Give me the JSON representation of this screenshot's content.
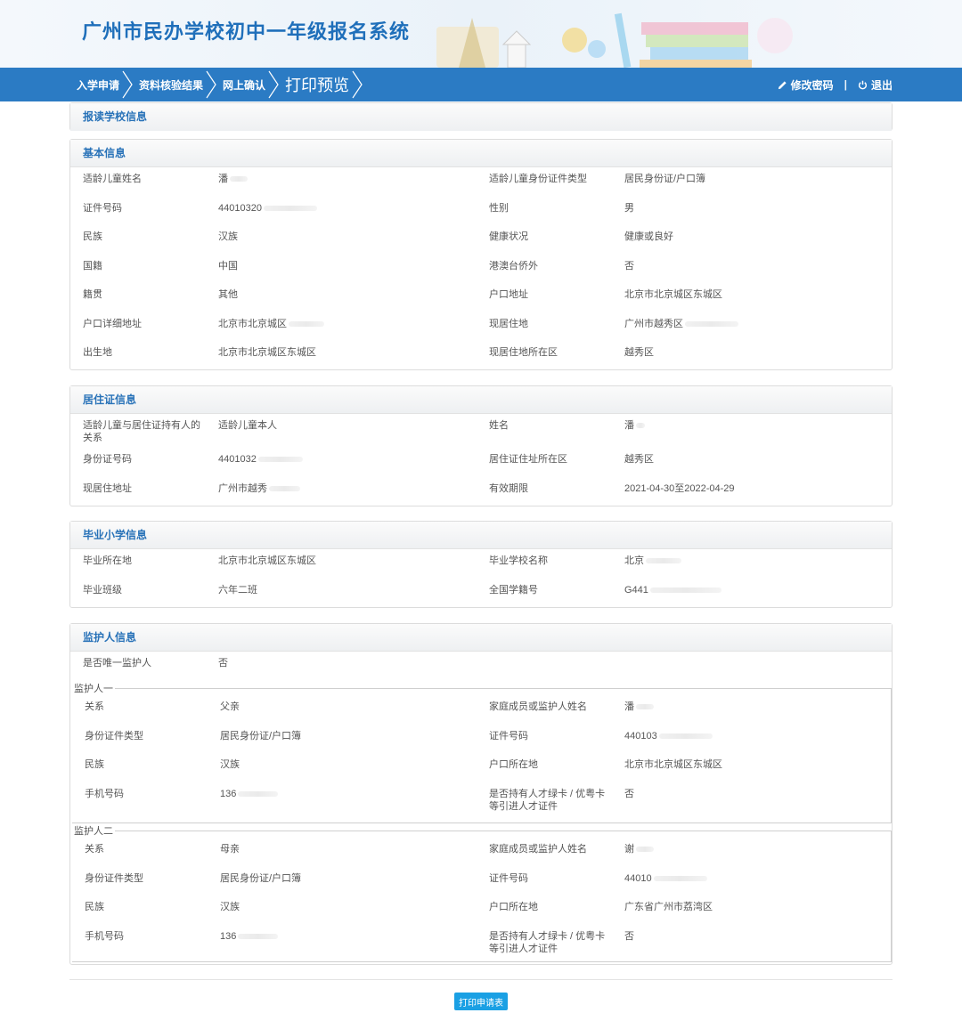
{
  "app": {
    "title": "广州市民办学校初中一年级报名系统"
  },
  "nav": {
    "steps": [
      "入学申请",
      "资料核验结果",
      "网上确认",
      "打印预览"
    ],
    "change_password": "修改密码",
    "separator": "|",
    "logout": "退出"
  },
  "school_section": {
    "title": "报读学校信息"
  },
  "basic": {
    "title": "基本信息",
    "rows": [
      [
        "适龄儿童姓名",
        "潘",
        "适龄儿童身份证件类型",
        "居民身份证/户口簿"
      ],
      [
        "证件号码",
        "44010320",
        "性别",
        "男"
      ],
      [
        "民族",
        "汉族",
        "健康状况",
        "健康或良好"
      ],
      [
        "国籍",
        "中国",
        "港澳台侨外",
        "否"
      ],
      [
        "籍贯",
        "其他",
        "户口地址",
        "北京市北京城区东城区"
      ],
      [
        "户口详细地址",
        "北京市北京城区",
        "现居住地",
        "广州市越秀区"
      ],
      [
        "出生地",
        "北京市北京城区东城区",
        "现居住地所在区",
        "越秀区"
      ]
    ]
  },
  "residence": {
    "title": "居住证信息",
    "rows": [
      [
        "适龄儿童与居住证持有人的关系",
        "适龄儿童本人",
        "姓名",
        "潘"
      ],
      [
        "身份证号码",
        "4401032",
        "居住证住址所在区",
        "越秀区"
      ],
      [
        "现居住地址",
        "广州市越秀",
        "有效期限",
        "2021-04-30至2022-04-29"
      ]
    ]
  },
  "primary": {
    "title": "毕业小学信息",
    "rows": [
      [
        "毕业所在地",
        "北京市北京城区东城区",
        "毕业学校名称",
        "北京"
      ],
      [
        "毕业班级",
        "六年二班",
        "全国学籍号",
        "G441"
      ]
    ]
  },
  "guardian": {
    "title": "监护人信息",
    "only_label": "是否唯一监护人",
    "only_value": "否",
    "g1": {
      "legend": "监护人一",
      "rows": [
        [
          "关系",
          "父亲",
          "家庭成员或监护人姓名",
          "潘"
        ],
        [
          "身份证件类型",
          "居民身份证/户口簿",
          "证件号码",
          "440103"
        ],
        [
          "民族",
          "汉族",
          "户口所在地",
          "北京市北京城区东城区"
        ],
        [
          "手机号码",
          "136",
          "是否持有人才绿卡 / 优粤卡等引进人才证件",
          "否"
        ]
      ]
    },
    "g2": {
      "legend": "监护人二",
      "rows": [
        [
          "关系",
          "母亲",
          "家庭成员或监护人姓名",
          "谢"
        ],
        [
          "身份证件类型",
          "居民身份证/户口簿",
          "证件号码",
          "44010"
        ],
        [
          "民族",
          "汉族",
          "户口所在地",
          "广东省广州市荔湾区"
        ],
        [
          "手机号码",
          "136",
          "是否持有人才绿卡 / 优粤卡等引进人才证件",
          "否"
        ]
      ]
    }
  },
  "footer": {
    "print_button": "打印申请表"
  },
  "colors": {
    "nav_bg": "#2b7bc4",
    "title": "#1f6fba",
    "section_title": "#2872b8",
    "print_button": "#1aa0e4"
  }
}
